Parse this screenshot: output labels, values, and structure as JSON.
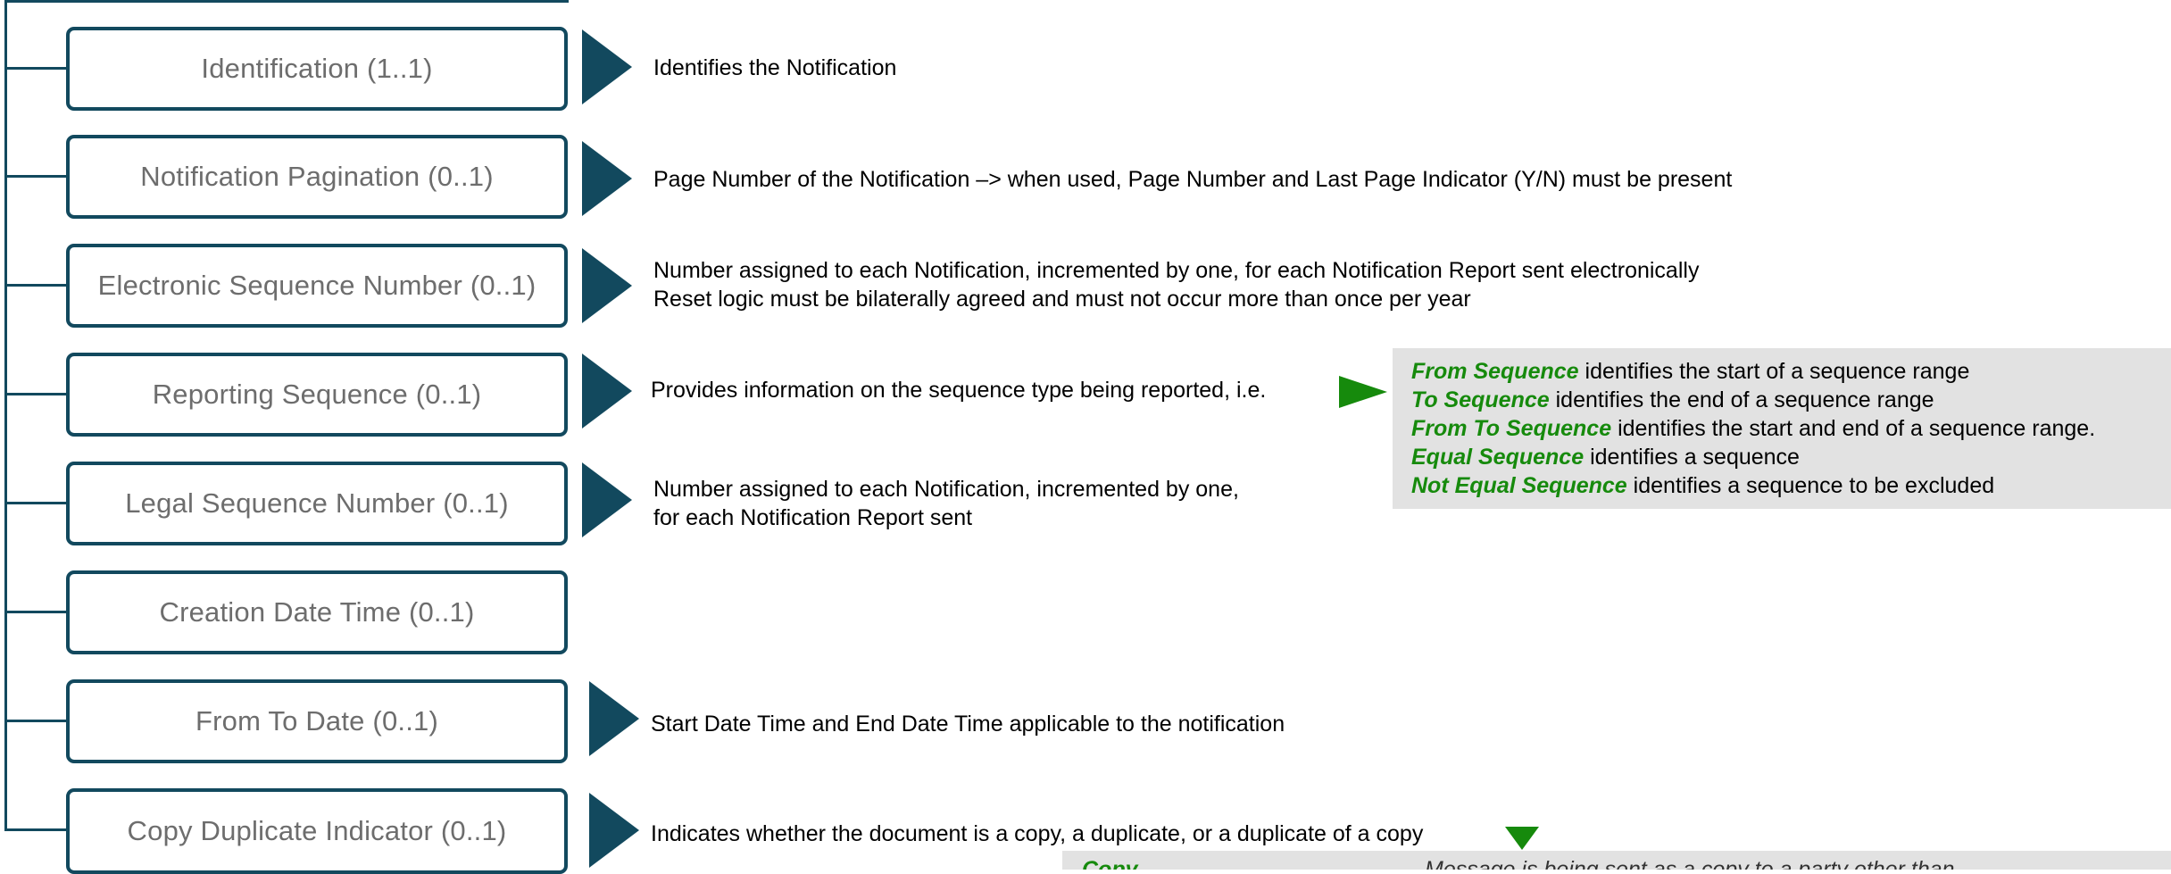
{
  "nodes": [
    {
      "label": "Identification  (1..1)",
      "description": [
        "Identifies the Notification"
      ]
    },
    {
      "label": "Notification  Pagination  (0..1)",
      "description": [
        "Page Number of the Notification –> when used, Page Number and Last Page Indicator (Y/N)  must be present"
      ]
    },
    {
      "label": "Electronic Sequence Number (0..1)",
      "description": [
        "Number assigned to each Notification, incremented by one, for each Notification Report sent electronically",
        "Reset logic must be bilaterally agreed and must not occur more than once per year"
      ]
    },
    {
      "label": "Reporting Sequence  (0..1)",
      "description": [
        "Provides information on the sequence type being reported, i.e."
      ]
    },
    {
      "label": "Legal Sequence Number (0..1)",
      "description": [
        "Number assigned to each Notification, incremented by one,",
        "for each Notification Report sent"
      ]
    },
    {
      "label": "Creation Date Time (0..1)",
      "description": []
    },
    {
      "label": "From To Date (0..1)",
      "description": [
        "Start Date Time and End Date Time applicable to the notification"
      ]
    },
    {
      "label": "Copy Duplicate Indicator  (0..1)",
      "description": [
        "Indicates whether the document is a copy, a duplicate, or a duplicate of a copy"
      ]
    }
  ],
  "sequence_types": [
    {
      "term": "From Sequence",
      "text": "identifies the start of a sequence range"
    },
    {
      "term": "To Sequence",
      "text": "identifies the end of a sequence range"
    },
    {
      "term": "From To Sequence",
      "text": "identifies the start and end of a sequence range."
    },
    {
      "term": "Equal Sequence",
      "text": "identifies a sequence"
    },
    {
      "term": "Not Equal Sequence",
      "text": "identifies a sequence to be excluded"
    }
  ],
  "copy_box": {
    "term": "Copy",
    "text": "Message is being sent as a copy to a party other than"
  },
  "colors": {
    "node_border": "#12495e",
    "accent_green": "#168a0c",
    "note_bg": "#e2e2e2"
  }
}
